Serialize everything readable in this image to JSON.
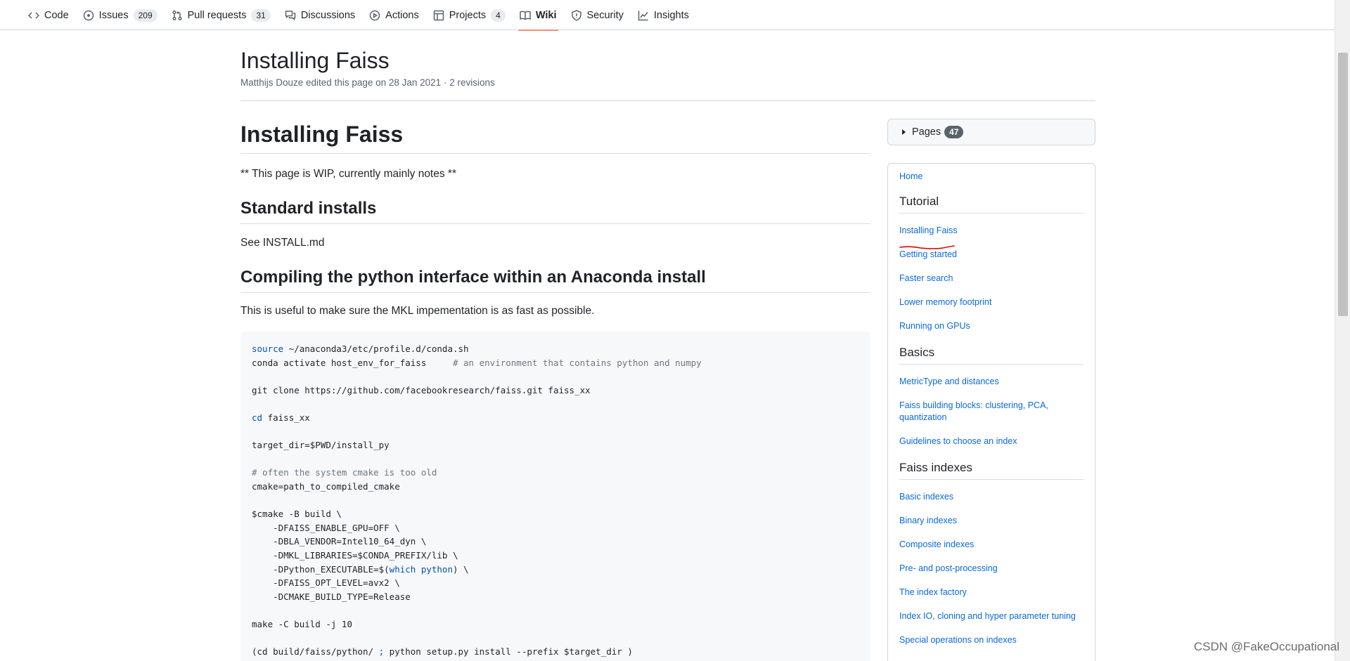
{
  "repo_nav": {
    "tabs": [
      {
        "label": "Code",
        "icon": "code-icon"
      },
      {
        "label": "Issues",
        "icon": "issue-icon",
        "count": "209"
      },
      {
        "label": "Pull requests",
        "icon": "pull-request-icon",
        "count": "31"
      },
      {
        "label": "Discussions",
        "icon": "discussion-icon"
      },
      {
        "label": "Actions",
        "icon": "play-icon"
      },
      {
        "label": "Projects",
        "icon": "table-icon",
        "count": "4"
      },
      {
        "label": "Wiki",
        "icon": "book-icon",
        "active": true
      },
      {
        "label": "Security",
        "icon": "shield-icon"
      },
      {
        "label": "Insights",
        "icon": "graph-icon"
      }
    ],
    "active_color": "#fd8c73"
  },
  "page": {
    "title": "Installing Faiss",
    "meta": "Matthijs Douze edited this page on 28 Jan 2021 · 2 revisions"
  },
  "content": {
    "h1": "Installing Faiss",
    "wip": "** This page is WIP, currently mainly notes **",
    "h_std": "Standard installs",
    "see": "See INSTALL.md",
    "h_compile": "Compiling the python interface within an Anaconda install",
    "useful": "This is useful to make sure the MKL impementation is as fast as possible.",
    "code": {
      "l1_kw": "source",
      "l1_rest": " ~/anaconda3/etc/profile.d/conda.sh",
      "l2_code": "conda activate host_env_for_faiss     ",
      "l2_comment": "# an environment that contains python and numpy",
      "l3": "git clone https://github.com/facebookresearch/faiss.git faiss_xx",
      "l4_kw": "cd",
      "l4_rest": " faiss_xx",
      "l5": "target_dir=$PWD/install_py",
      "l6_comment": "# often the system cmake is too old",
      "l7": "cmake=path_to_compiled_cmake",
      "l8": "$cmake -B build \\",
      "l9": "    -DFAISS_ENABLE_GPU=OFF \\",
      "l10": "    -DBLA_VENDOR=Intel10_64_dyn \\",
      "l11": "    -DMKL_LIBRARIES=$CONDA_PREFIX/lib \\",
      "l12_a": "    -DPython_EXECUTABLE=$(",
      "l12_kw": "which python",
      "l12_b": ") \\",
      "l13": "    -DFAISS_OPT_LEVEL=avx2 \\",
      "l14": "    -DCMAKE_BUILD_TYPE=Release",
      "l15": "make -C build -j 10",
      "l16_a": "(cd build/faiss/python/ ",
      "l16_kw": ";",
      "l16_b": " python setup.py install --prefix $target_dir )"
    }
  },
  "sidebar": {
    "pages_label": "Pages",
    "pages_count": "47",
    "home": "Home",
    "tutorial": {
      "heading": "Tutorial",
      "items": [
        "Installing Faiss",
        "Getting started",
        "Faster search",
        "Lower memory footprint",
        "Running on GPUs"
      ]
    },
    "basics": {
      "heading": "Basics",
      "items": [
        "MetricType and distances",
        "Faiss building blocks: clustering, PCA, quantization",
        "Guidelines to choose an index"
      ]
    },
    "indexes": {
      "heading": "Faiss indexes",
      "items": [
        "Basic indexes",
        "Binary indexes",
        "Composite indexes",
        "Pre- and post-processing",
        "The index factory",
        "Index IO, cloning and hyper parameter tuning",
        "Special operations on indexes"
      ]
    },
    "link_color": "#0969da",
    "annotation_color": "#e00000"
  },
  "watermark": "CSDN @FakeOccupational"
}
